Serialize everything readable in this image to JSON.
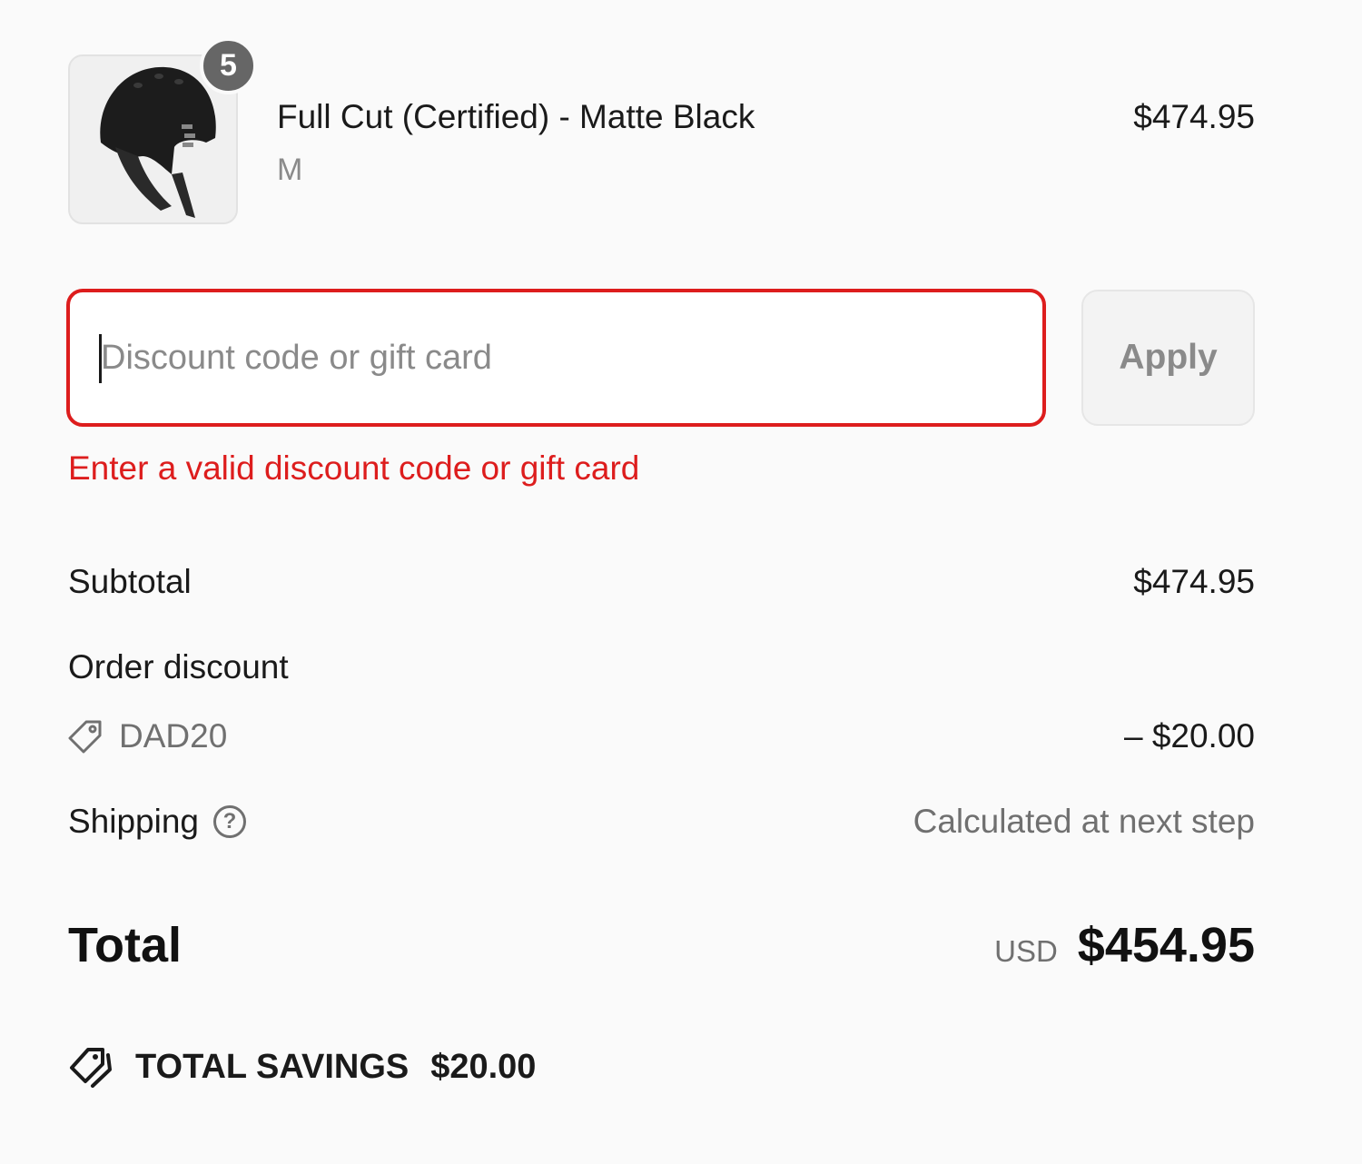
{
  "line_item": {
    "quantity": "5",
    "title": "Full Cut (Certified) - Matte Black",
    "variant": "M",
    "price": "$474.95",
    "image_icon": "helmet-icon"
  },
  "discount": {
    "placeholder": "Discount code or gift card",
    "value": "",
    "apply_label": "Apply",
    "error": "Enter a valid discount code or gift card"
  },
  "summary": {
    "subtotal_label": "Subtotal",
    "subtotal_value": "$474.95",
    "order_discount_label": "Order discount",
    "discount_code": "DAD20",
    "discount_value": "– $20.00",
    "shipping_label": "Shipping",
    "shipping_value": "Calculated at next step",
    "total_label": "Total",
    "currency": "USD",
    "total_value": "$454.95",
    "savings_label": "TOTAL SAVINGS",
    "savings_value": "$20.00"
  },
  "colors": {
    "error": "#dd1d1d",
    "muted": "#707070",
    "background": "#fafafa"
  }
}
